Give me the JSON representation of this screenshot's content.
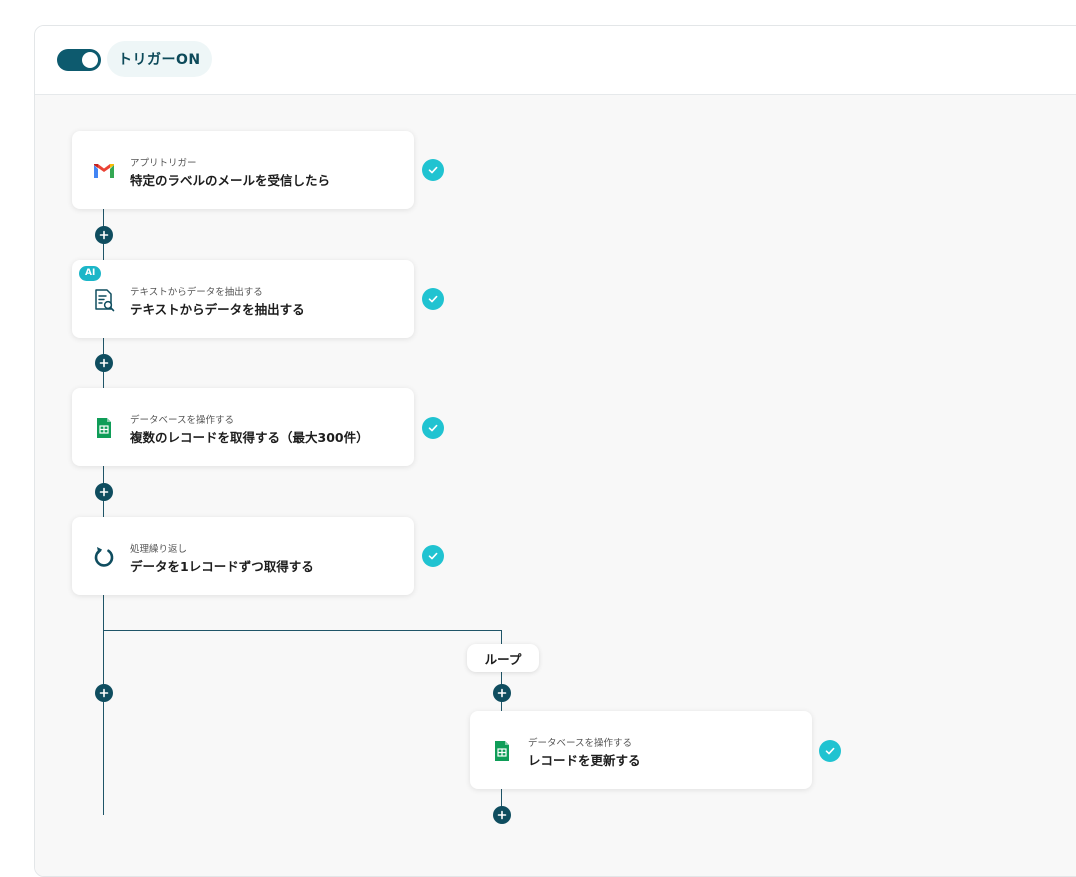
{
  "header": {
    "trigger_label": "トリガーON",
    "trigger_on": true
  },
  "steps": [
    {
      "sub": "アプリトリガー",
      "title": "特定のラベルのメールを受信したら",
      "icon": "gmail-icon"
    },
    {
      "sub": "テキストからデータを抽出する",
      "title": "テキストからデータを抽出する",
      "icon": "document-search-icon",
      "badge": "AI"
    },
    {
      "sub": "データベースを操作する",
      "title": "複数のレコードを取得する（最大300件）",
      "icon": "google-sheets-icon"
    },
    {
      "sub": "処理繰り返し",
      "title": "データを1レコードずつ取得する",
      "icon": "loop-icon"
    },
    {
      "sub": "データベースを操作する",
      "title": "レコードを更新する",
      "icon": "google-sheets-icon"
    }
  ],
  "loop": {
    "label": "ループ"
  },
  "colors": {
    "primary": "#0d5a6e",
    "check": "#20c3d1",
    "sheets_green": "#0f9d58"
  }
}
